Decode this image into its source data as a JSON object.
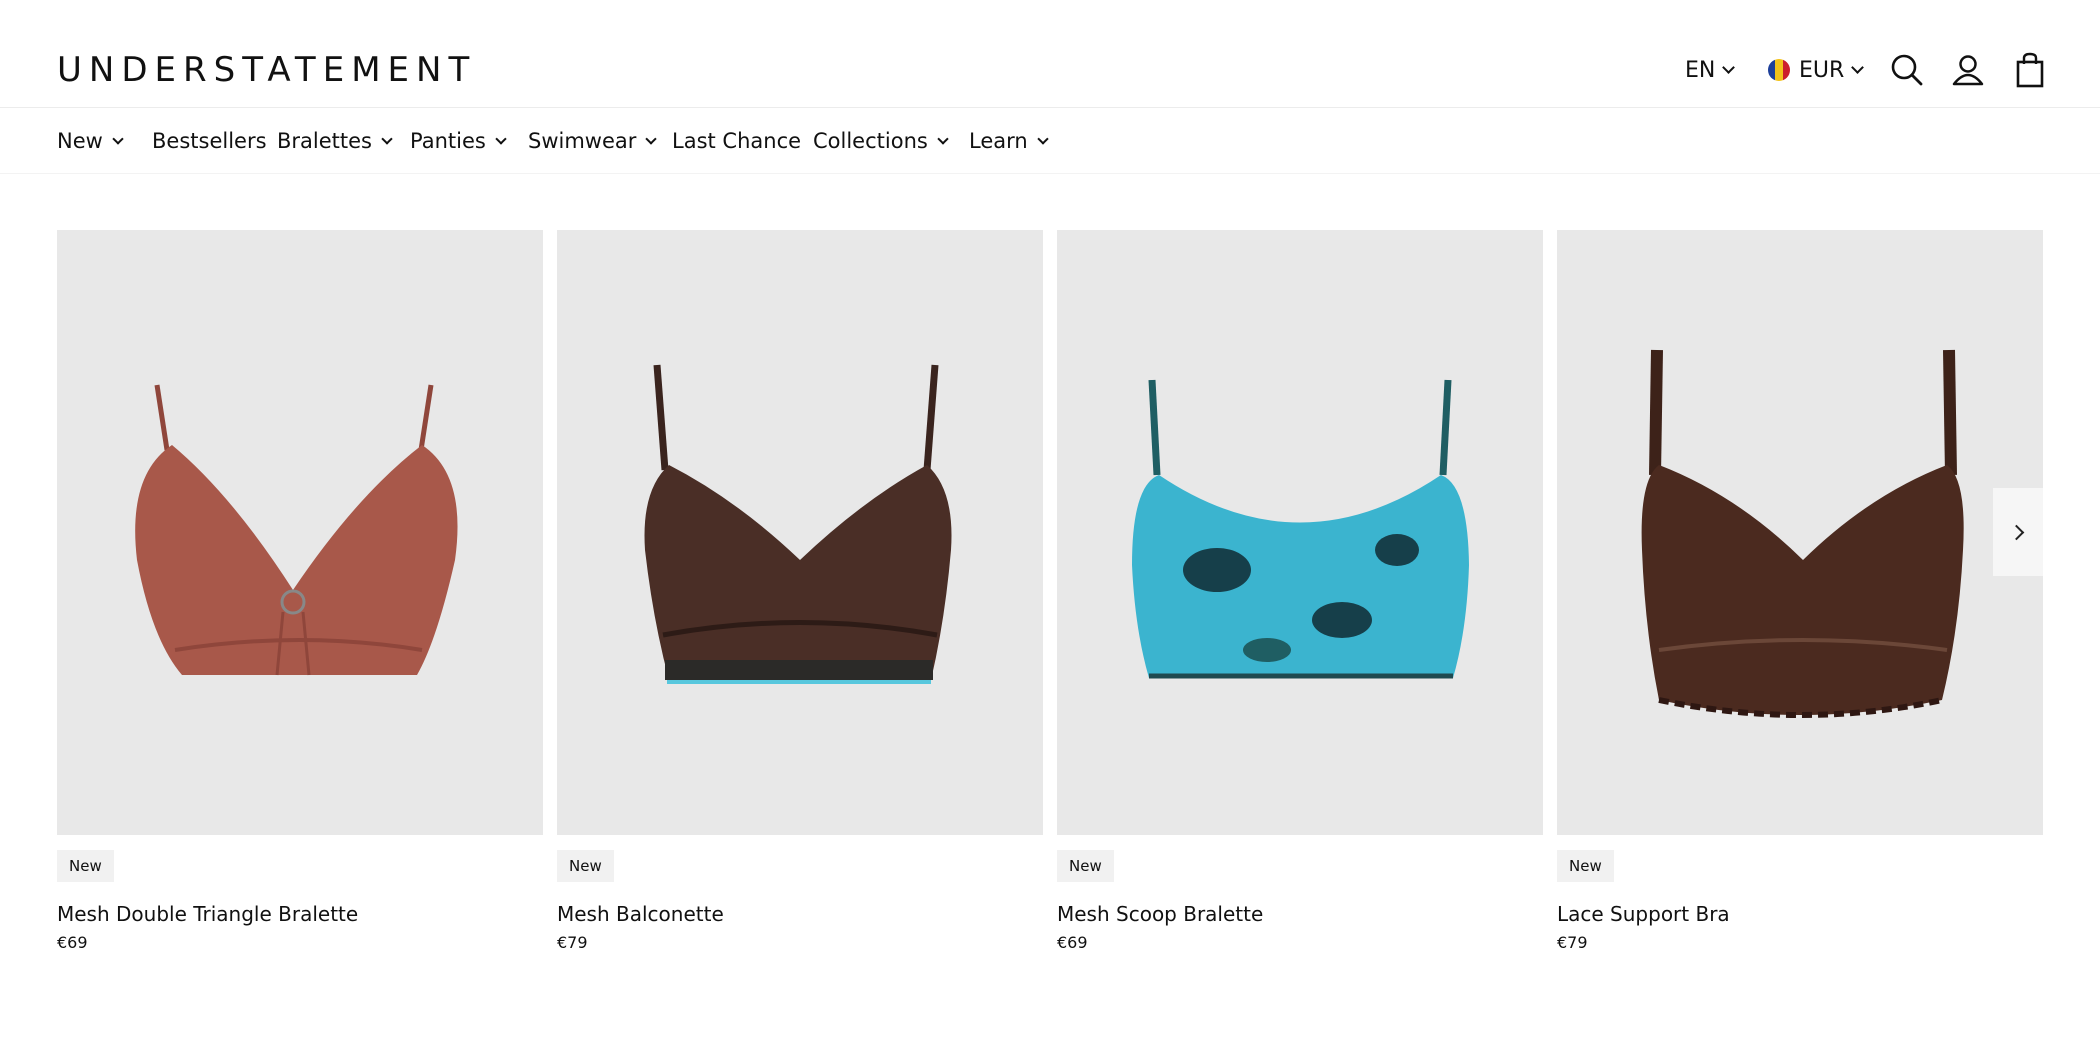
{
  "header": {
    "logo": "UNDERSTATEMENT",
    "language": "EN",
    "currency": "EUR",
    "icons": [
      "search-icon",
      "account-icon",
      "cart-icon"
    ]
  },
  "nav": {
    "items": [
      {
        "label": "New",
        "has_dropdown": true
      },
      {
        "label": "Bestsellers",
        "has_dropdown": false
      },
      {
        "label": "Bralettes",
        "has_dropdown": true
      },
      {
        "label": "Panties",
        "has_dropdown": true
      },
      {
        "label": "Swimwear",
        "has_dropdown": true
      },
      {
        "label": "Last Chance",
        "has_dropdown": false
      },
      {
        "label": "Collections",
        "has_dropdown": true
      },
      {
        "label": "Learn",
        "has_dropdown": true
      }
    ]
  },
  "products": [
    {
      "badge": "New",
      "name": "Mesh Double Triangle Bralette",
      "price": "€69",
      "color": "#a8584a"
    },
    {
      "badge": "New",
      "name": "Mesh Balconette",
      "price": "€79",
      "color": "#4a2e26"
    },
    {
      "badge": "New",
      "name": "Mesh Scoop Bralette",
      "price": "€69",
      "color": "#3bb4cf"
    },
    {
      "badge": "New",
      "name": "Lace Support Bra",
      "price": "€79",
      "color": "#4b2a1f"
    }
  ],
  "carousel": {
    "next_icon": "chevron-right-icon"
  },
  "colors": {
    "image_bg": "#e8e8e8",
    "badge_bg": "#f1f1f1"
  }
}
